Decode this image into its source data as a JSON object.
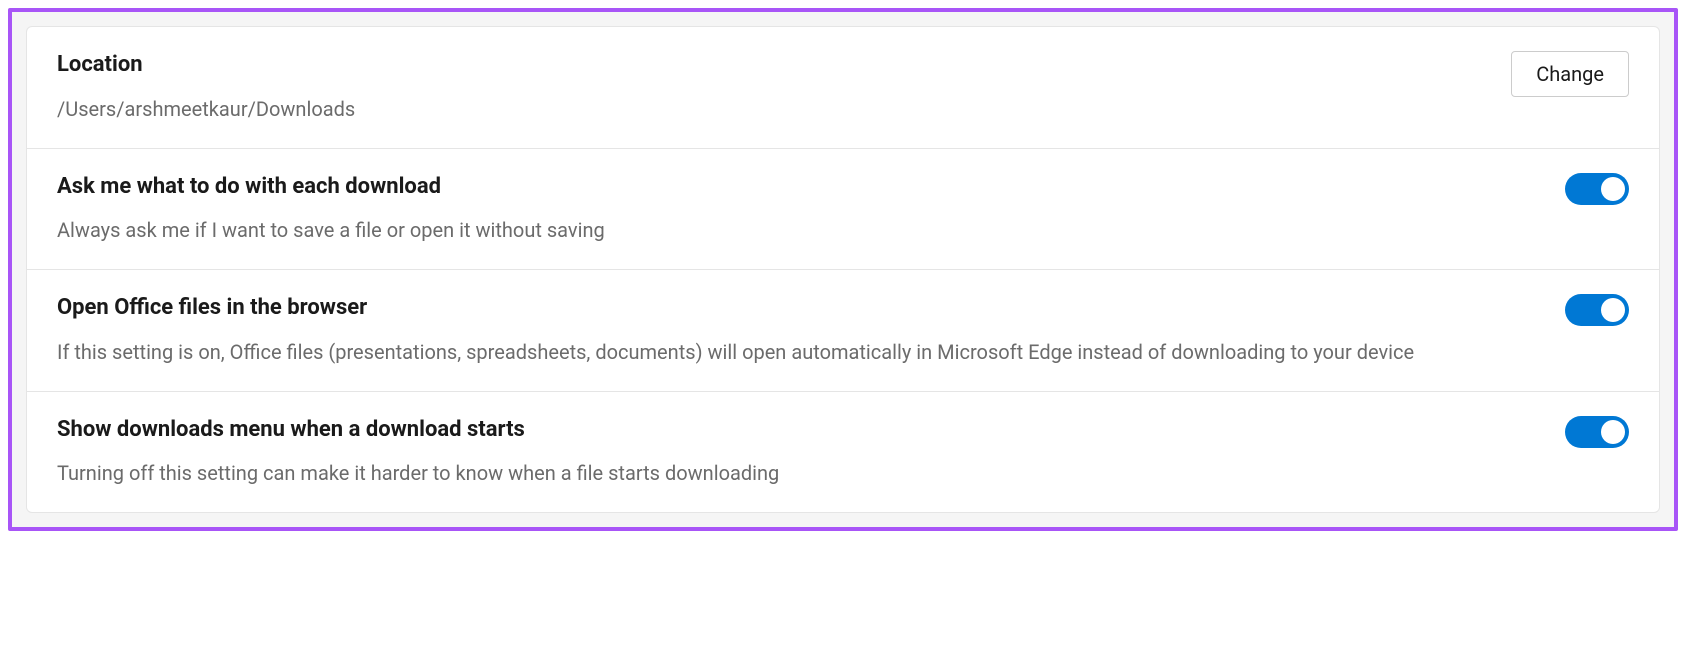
{
  "location": {
    "title": "Location",
    "path": "/Users/arshmeetkaur/Downloads",
    "button_label": "Change"
  },
  "ask_download": {
    "title": "Ask me what to do with each download",
    "description": "Always ask me if I want to save a file or open it without saving",
    "enabled": true
  },
  "office_files": {
    "title": "Open Office files in the browser",
    "description": "If this setting is on, Office files (presentations, spreadsheets, documents) will open automatically in Microsoft Edge instead of downloading to your device",
    "enabled": true
  },
  "show_menu": {
    "title": "Show downloads menu when a download starts",
    "description": "Turning off this setting can make it harder to know when a file starts downloading",
    "enabled": true
  }
}
